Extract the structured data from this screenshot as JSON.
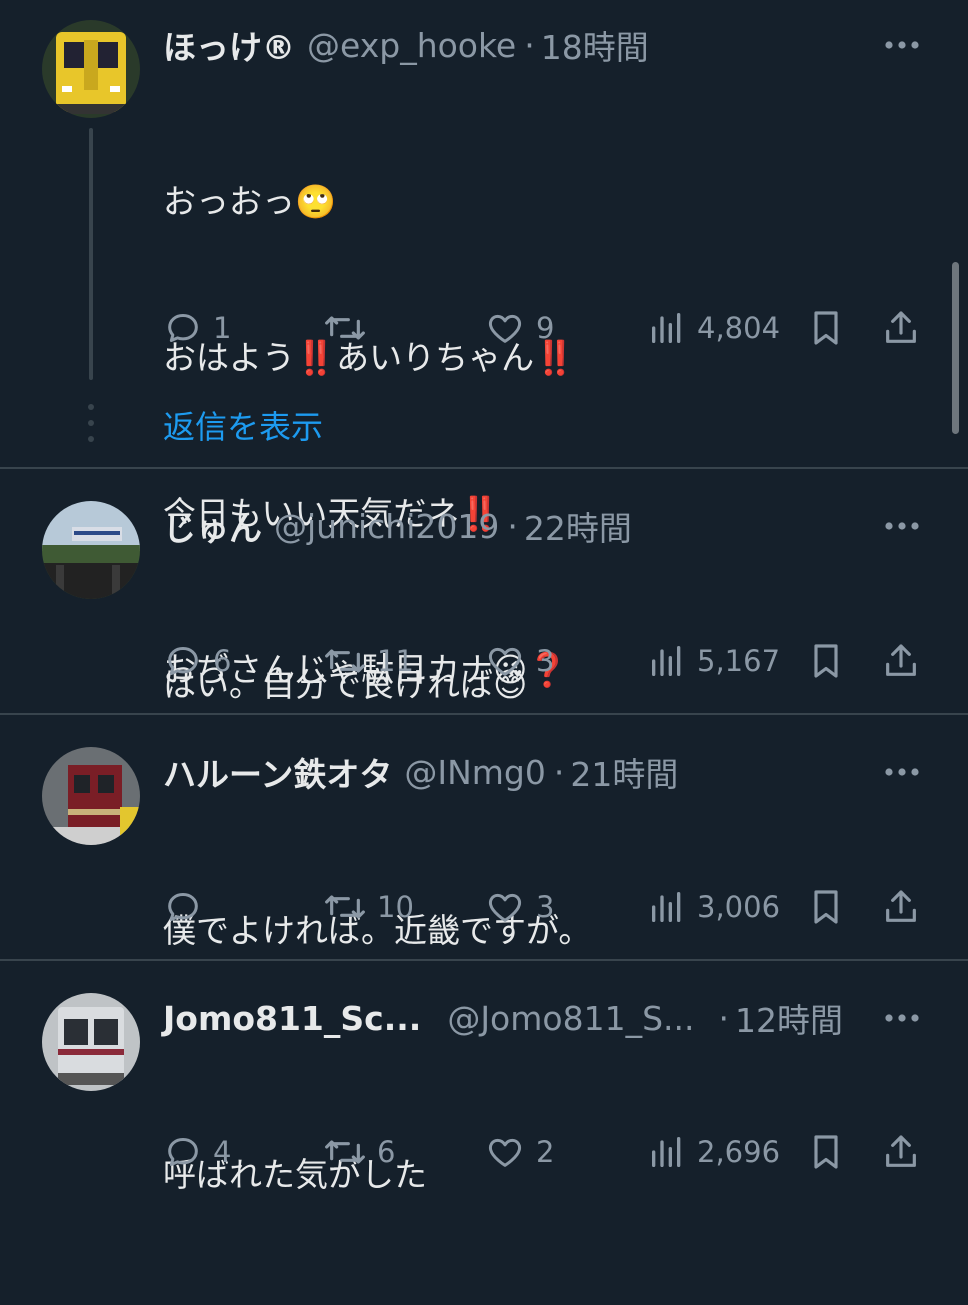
{
  "tweets": [
    {
      "name": "ほっけ®",
      "handle": "@exp_hooke",
      "dot": "·",
      "time": "18時間",
      "lines": [
        "おっおっ🙄",
        "おはよう‼️あいりちゃん‼️",
        "今日もいい天気だネ‼️",
        "おぢさんじゃ駄目カナ😘❓"
      ],
      "replies": "1",
      "retweets": "",
      "likes": "9",
      "views": "4,804",
      "show_replies": "返信を表示"
    },
    {
      "name": "じゅん",
      "handle": "@junichi2019",
      "dot": "·",
      "time": "22時間",
      "lines": [
        "はい。自分で良ければ😊"
      ],
      "replies": "6",
      "retweets": "11",
      "likes": "3",
      "views": "5,167"
    },
    {
      "name": "ハルーン鉄オタ",
      "handle": "@INmg0",
      "dot": "·",
      "time": "21時間",
      "lines": [
        "僕でよければ。近畿ですが。"
      ],
      "replies": "",
      "retweets": "10",
      "likes": "3",
      "views": "3,006"
    },
    {
      "name": "Jomo811_Sc...",
      "handle": "@Jomo811_S...",
      "dot": "·",
      "time": "12時間",
      "lines": [
        "呼ばれた気がした"
      ],
      "replies": "4",
      "retweets": "6",
      "likes": "2",
      "views": "2,696"
    }
  ],
  "colors": {
    "background": "#15202b",
    "text": "#e7e9ea",
    "muted": "#8b98a5",
    "link": "#1d9bf0",
    "divider": "#38444d"
  },
  "icons": [
    "reply-icon",
    "retweet-icon",
    "like-icon",
    "views-icon",
    "bookmark-icon",
    "share-icon",
    "more-icon"
  ]
}
